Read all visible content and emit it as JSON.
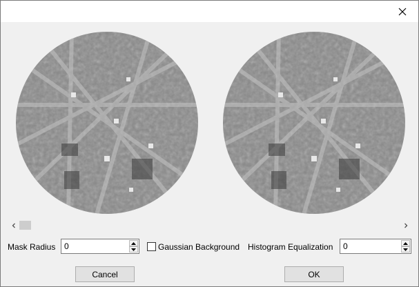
{
  "window": {
    "close_icon": "close-icon"
  },
  "scrollbar": {
    "left_icon": "chevron-left-icon",
    "right_icon": "chevron-right-icon",
    "position": 0
  },
  "controls": {
    "mask_radius_label": "Mask Radius",
    "mask_radius_value": "0",
    "gaussian_label": "Gaussian Background",
    "gaussian_checked": false,
    "histogram_label": "Histogram Equalization",
    "histogram_value": "0"
  },
  "buttons": {
    "cancel_label": "Cancel",
    "ok_label": "OK"
  },
  "colors": {
    "dialog_bg": "#f0f0f0",
    "button_bg": "#e1e1e1",
    "scroll_thumb": "#cdcdcd"
  }
}
